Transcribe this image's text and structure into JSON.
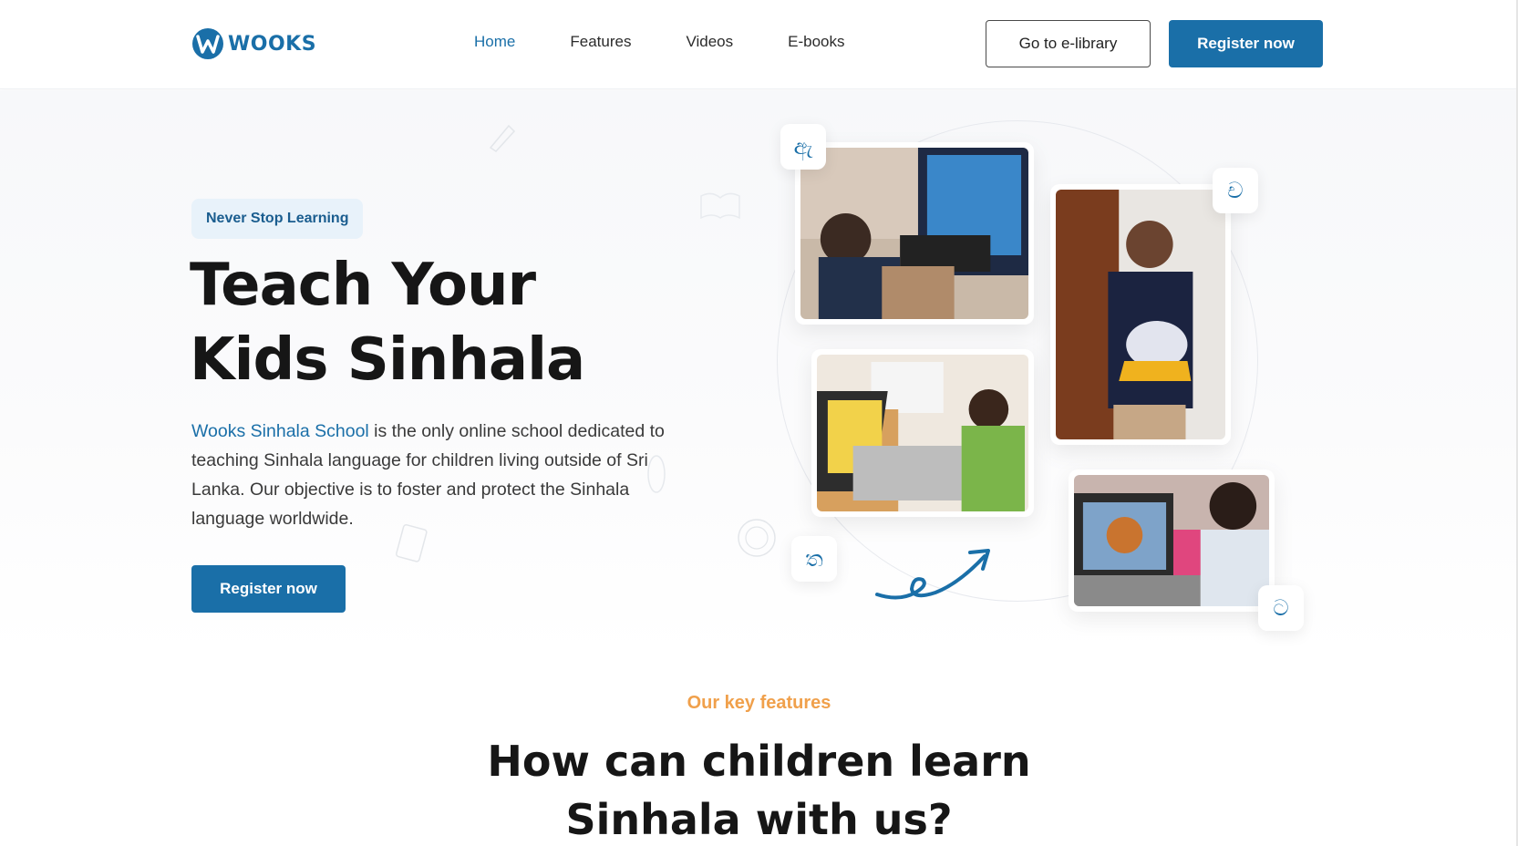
{
  "brand": {
    "name": "WOOKS",
    "color": "#1a6fa8"
  },
  "nav": {
    "items": [
      {
        "label": "Home",
        "active": true
      },
      {
        "label": "Features",
        "active": false
      },
      {
        "label": "Videos",
        "active": false
      },
      {
        "label": "E-books",
        "active": false
      }
    ]
  },
  "header": {
    "library_button": "Go to e-library",
    "register_button": "Register now"
  },
  "hero": {
    "badge": "Never Stop Learning",
    "title_line1": "Teach Your",
    "title_line2": "Kids Sinhala",
    "desc_link": "Wooks Sinhala School",
    "desc_rest": " is the only online school dedicated to teaching Sinhala language for children living outside of Sri Lanka. Our objective is to foster and protect the Sinhala language worldwide.",
    "register_button": "Register now"
  },
  "collage": {
    "letters": [
      "ඇ",
      "ච",
      "ත",
      "ට"
    ],
    "photos": [
      {
        "name": "child-at-computer"
      },
      {
        "name": "child-with-elephant-craft"
      },
      {
        "name": "child-at-laptop"
      },
      {
        "name": "girl-at-laptop"
      }
    ]
  },
  "features": {
    "kicker": "Our key features",
    "title_line1": "How can children learn",
    "title_line2": "Sinhala with us?"
  },
  "colors": {
    "accent": "#1a6fa8",
    "kicker": "#f0a04b",
    "badge_bg": "#e8f2fa"
  }
}
